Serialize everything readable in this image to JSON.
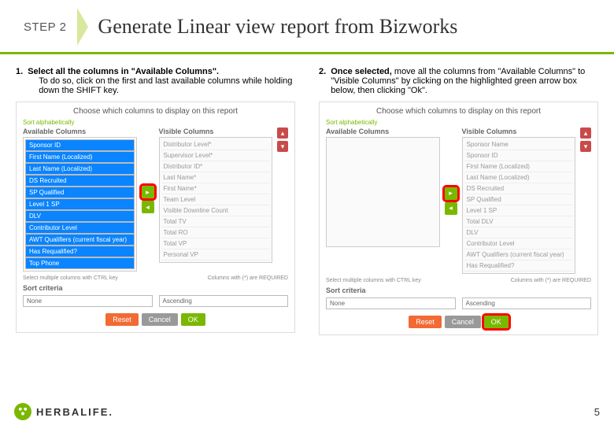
{
  "header": {
    "step": "STEP 2",
    "title": "Generate Linear view report from Bizworks"
  },
  "instructions": {
    "i1": {
      "n": "1.",
      "bold": "Select all the columns in \"Available Columns\".",
      "rest": "To do so, click on the first and last available columns while holding down the SHIFT key."
    },
    "i2": {
      "n": "2.",
      "bold": "Once selected,",
      "rest": "move all the columns from \"Available Columns\" to \"Visible Columns\" by clicking on the highlighted green arrow box below, then clicking \"Ok\"."
    }
  },
  "panel": {
    "title": "Choose which columns to display on this report",
    "sortlink": "Sort alphabetically",
    "availHead": "Available Columns",
    "visHead": "Visible Columns",
    "avail1": [
      "Sponsor ID",
      "First Name (Localized)",
      "Last Name (Localized)",
      "DS Recruited",
      "SP Qualified",
      "Level 1 SP",
      "DLV",
      "Contributor Level",
      "AWT Qualifiers (current fiscal year)",
      "Has Requalified?",
      "Top Phone"
    ],
    "vis1": [
      "Distributor Level*",
      "Supervisor Level*",
      "Distributor ID*",
      "Last Name*",
      "First Name*",
      "Team Level",
      "Visible Downline Count",
      "Total TV",
      "Total RO",
      "Total VP",
      "Personal VP"
    ],
    "avail2": [],
    "vis2": [
      "Sponsor Name",
      "Sponsor ID",
      "First Name (Localized)",
      "Last Name (Localized)",
      "DS Recruited",
      "SP Qualified",
      "Level 1 SP",
      "Total DLV",
      "DLV",
      "Contributor Level",
      "AWT Qualifiers (current fiscal year)",
      "Has Requalified?"
    ],
    "noteL": "Select multiple columns with CTRL key",
    "noteR": "Columns with (*) are REQUIRED",
    "sortLabel": "Sort criteria",
    "sortNone": "None",
    "sortAsc": "Ascending",
    "reset": "Reset",
    "cancel": "Cancel",
    "ok": "OK"
  },
  "brand": "HERBALIFE.",
  "page": "5"
}
